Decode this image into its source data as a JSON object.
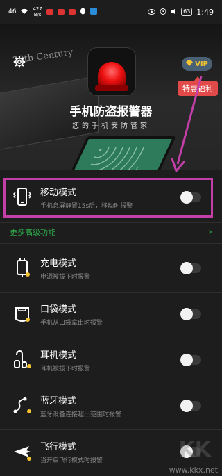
{
  "statusbar": {
    "signal": "46",
    "net_speed_value": "427",
    "net_speed_unit": "B/s",
    "battery": "63",
    "time": "1:49"
  },
  "hero": {
    "laptop_text": "20th Century",
    "title": "手机防盗报警器",
    "subtitle": "您的手机安防管家",
    "vip_label": "VIP",
    "promo_label": "特惠福利"
  },
  "modes": [
    {
      "icon": "phone-vibrate-icon",
      "title": "移动模式",
      "desc": "手机息屏静置15s后，移动时报警"
    },
    {
      "icon": "charger-icon",
      "title": "充电模式",
      "desc": "电源被拔下时报警"
    },
    {
      "icon": "pocket-icon",
      "title": "口袋模式",
      "desc": "手机从口袋拿出时报警"
    },
    {
      "icon": "earphone-icon",
      "title": "耳机模式",
      "desc": "耳机被拔下时报警"
    },
    {
      "icon": "bluetooth-route-icon",
      "title": "蓝牙模式",
      "desc": "蓝牙设备连接超出范围时报警"
    },
    {
      "icon": "airplane-icon",
      "title": "飞行模式",
      "desc": "当开启飞行模式时报警"
    }
  ],
  "more": {
    "label": "更多高级功能"
  },
  "watermark": {
    "big": "KK",
    "url": "www.kkx.net"
  },
  "colors": {
    "accent_green": "#2eae4a",
    "highlight": "#c23fa8",
    "promo": "#e24a4a",
    "vip_gold": "#f4c430"
  }
}
